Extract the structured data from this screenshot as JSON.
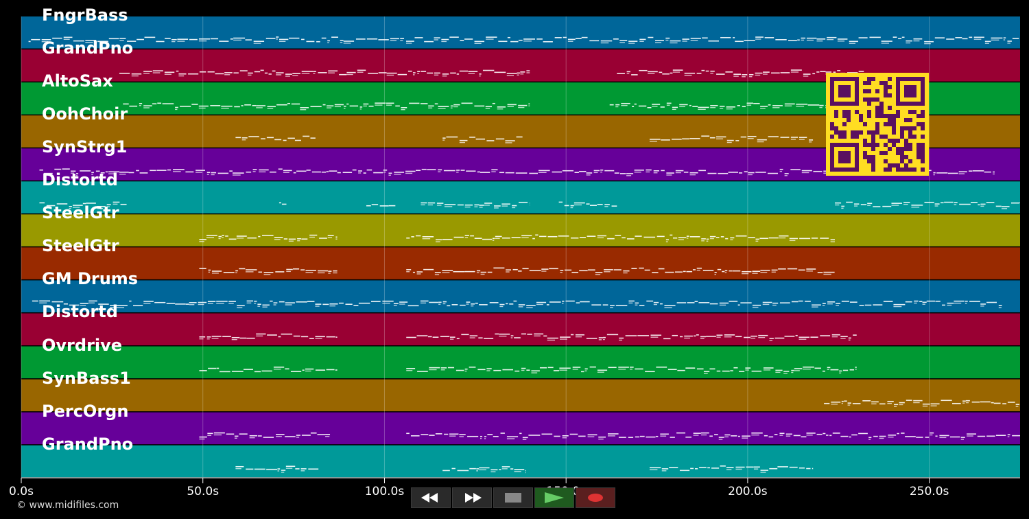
{
  "tracks": [
    {
      "name": "FngrBass",
      "color": "#006699"
    },
    {
      "name": "GrandPno",
      "color": "#990033"
    },
    {
      "name": "AltoSax",
      "color": "#009933"
    },
    {
      "name": "OohChoir",
      "color": "#996600"
    },
    {
      "name": "SynStrg1",
      "color": "#660099"
    },
    {
      "name": "Distortd",
      "color": "#009999"
    },
    {
      "name": "SteelGtr",
      "color": "#999900"
    },
    {
      "name": "SteelGtr",
      "color": "#992a00"
    },
    {
      "name": "GM Drums",
      "color": "#006699"
    },
    {
      "name": "Distortd",
      "color": "#990033"
    },
    {
      "name": "Ovrdrive",
      "color": "#009933"
    },
    {
      "name": "SynBass1",
      "color": "#996600"
    },
    {
      "name": "PercOrgn",
      "color": "#660099"
    },
    {
      "name": "GrandPno",
      "color": "#009999"
    }
  ],
  "timeline": {
    "ticks": [
      "0.0s",
      "50.0s",
      "100.0s",
      "150.0s",
      "200.0s",
      "250.0s"
    ],
    "tick_values": [
      0,
      50,
      100,
      150,
      200,
      250
    ],
    "max_seconds": 275
  },
  "note_segments": [
    [
      [
        2,
        275
      ]
    ],
    [
      [
        27,
        140
      ],
      [
        164,
        232
      ]
    ],
    [
      [
        28,
        140
      ],
      [
        162,
        224
      ]
    ],
    [
      [
        59,
        81
      ],
      [
        116,
        138
      ],
      [
        173,
        218
      ]
    ],
    [
      [
        5,
        268
      ]
    ],
    [
      [
        5,
        29
      ],
      [
        71,
        73
      ],
      [
        95,
        103
      ],
      [
        110,
        140
      ],
      [
        148,
        164
      ],
      [
        224,
        275
      ]
    ],
    [
      [
        49,
        87
      ],
      [
        106,
        224
      ]
    ],
    [
      [
        49,
        87
      ],
      [
        106,
        224
      ]
    ],
    [
      [
        3,
        270
      ]
    ],
    [
      [
        49,
        87
      ],
      [
        106,
        230
      ]
    ],
    [
      [
        49,
        87
      ],
      [
        106,
        230
      ]
    ],
    [
      [
        221,
        275
      ]
    ],
    [
      [
        49,
        85
      ],
      [
        106,
        275
      ]
    ],
    [
      [
        59,
        82
      ],
      [
        116,
        139
      ],
      [
        173,
        218
      ]
    ]
  ],
  "transport": {
    "rewind": "rewind-icon",
    "fast_forward": "fast-forward-icon",
    "stop": "stop-icon",
    "play": "play-icon",
    "record": "record-icon"
  },
  "colors": {
    "qr_fg": "#5a1060",
    "qr_bg": "#ffdd22"
  },
  "copyright": "© www.midifiles.com"
}
